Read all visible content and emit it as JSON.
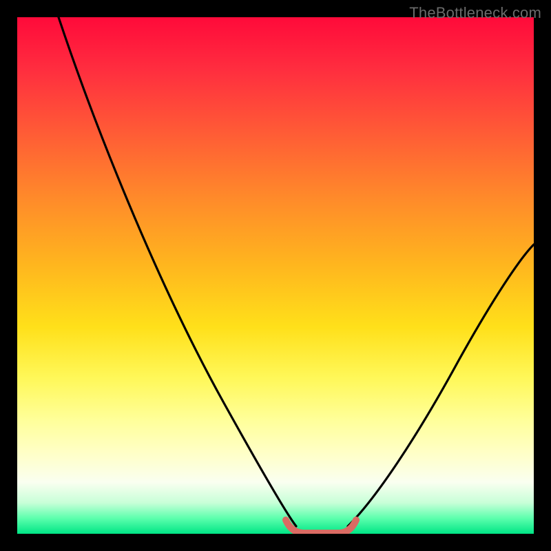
{
  "watermark": "TheBottleneck.com",
  "chart_data": {
    "type": "line",
    "title": "",
    "xlabel": "",
    "ylabel": "",
    "xlim": [
      0,
      100
    ],
    "ylim": [
      0,
      100
    ],
    "grid": false,
    "legend": false,
    "background_gradient": {
      "top": "#ff0a3a",
      "middle": "#ffe01a",
      "bottom": "#00e585"
    },
    "series": [
      {
        "name": "left-curve",
        "color": "#000000",
        "x": [
          8,
          12,
          18,
          25,
          32,
          38,
          44,
          49,
          52,
          54
        ],
        "y": [
          100,
          86,
          70,
          54,
          38,
          24,
          12,
          5,
          1.5,
          0
        ]
      },
      {
        "name": "right-curve",
        "color": "#000000",
        "x": [
          62,
          65,
          70,
          76,
          83,
          90,
          96,
          100
        ],
        "y": [
          0,
          2,
          7,
          14,
          24,
          36,
          48,
          56
        ]
      },
      {
        "name": "flat-segment",
        "color": "#da6b63",
        "x": [
          52,
          54,
          56,
          58,
          60,
          62,
          64
        ],
        "y": [
          1.5,
          0.4,
          0,
          0,
          0,
          0.4,
          1.5
        ]
      }
    ],
    "annotations": []
  }
}
